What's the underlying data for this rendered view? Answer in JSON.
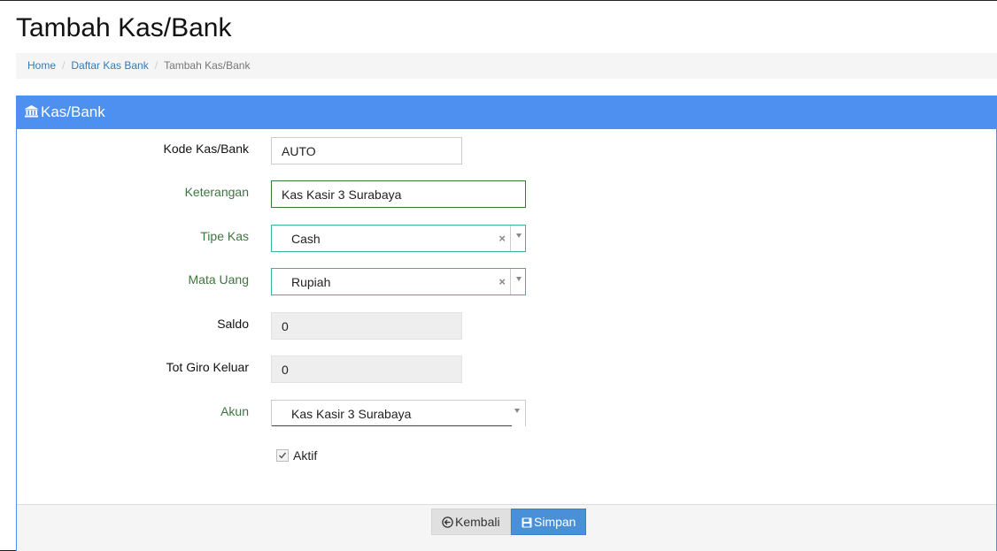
{
  "page": {
    "title": "Tambah Kas/Bank"
  },
  "breadcrumb": {
    "home": "Home",
    "list": "Daftar Kas Bank",
    "current": "Tambah Kas/Bank",
    "separator": "/"
  },
  "panel": {
    "heading": "Kas/Bank",
    "heading_icon": "bank-icon"
  },
  "form": {
    "kode": {
      "label": "Kode Kas/Bank",
      "value": "AUTO"
    },
    "keterangan": {
      "label": "Keterangan",
      "value": "Kas Kasir 3 Surabaya"
    },
    "tipe_kas": {
      "label": "Tipe Kas",
      "value": "Cash",
      "clear": "×"
    },
    "mata_uang": {
      "label": "Mata Uang",
      "value": "Rupiah",
      "clear": "×"
    },
    "saldo": {
      "label": "Saldo",
      "value": "0"
    },
    "tot_giro": {
      "label": "Tot Giro Keluar",
      "value": "0"
    },
    "akun": {
      "label": "Akun",
      "value": "Kas Kasir 3 Surabaya"
    },
    "aktif": {
      "label": "Aktif",
      "checked": true
    }
  },
  "footer": {
    "back_label": "Kembali",
    "back_icon": "arrow-circle-left-icon",
    "save_label": "Simpan",
    "save_icon": "floppy-disk-icon"
  },
  "colors": {
    "primary": "#4d90f0",
    "success_label": "#3c763d",
    "link": "#337ab7"
  }
}
